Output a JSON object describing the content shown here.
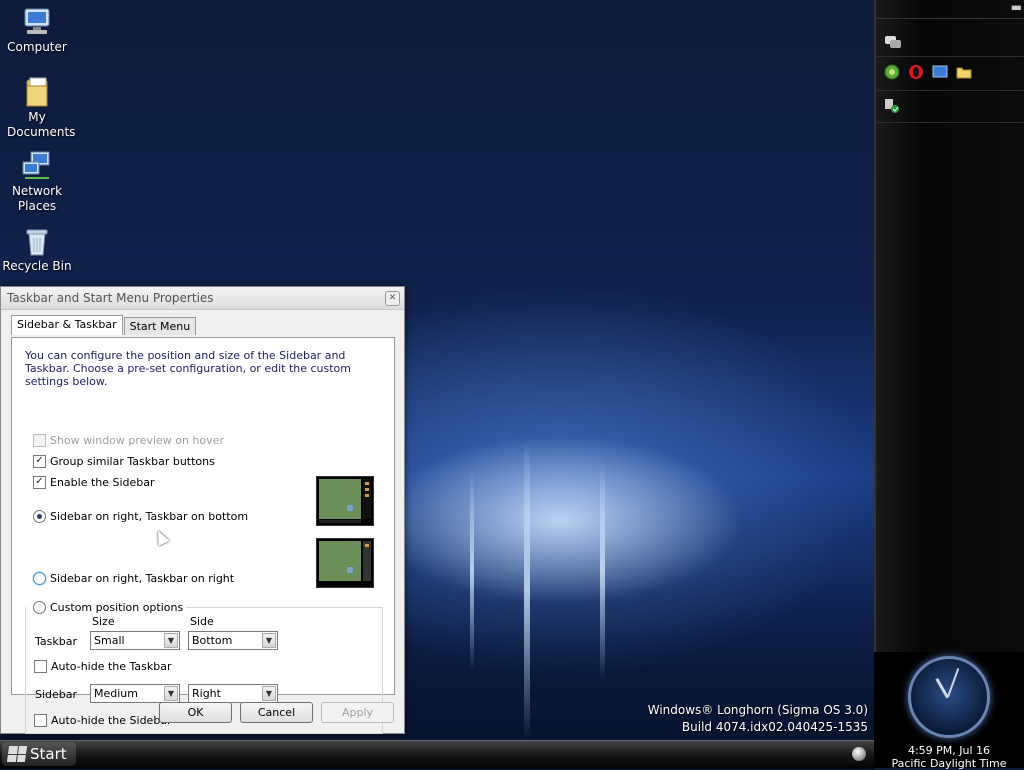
{
  "desktop": {
    "icons": [
      {
        "label": "Computer",
        "icon": "computer-icon"
      },
      {
        "label": "My Documents",
        "icon": "documents-folder-icon"
      },
      {
        "label": "Network Places",
        "icon": "network-icon"
      },
      {
        "label": "Recycle Bin",
        "icon": "recycle-bin-icon"
      }
    ],
    "watermark": {
      "line1": "Windows® Longhorn (Sigma OS 3.0)",
      "line2": "Build 4074.idx02.040425-1535"
    }
  },
  "sidebar": {
    "close_glyph": "▬",
    "tiles": [
      "chat-bubble-icon",
      "green-orb-icon",
      "opera-icon",
      "screen-icon",
      "folder-icon",
      "task-check-icon"
    ],
    "clock": {
      "time": "4:59 PM, Jul 16",
      "timezone": "Pacific Daylight Time"
    }
  },
  "taskbar": {
    "start_label": "Start"
  },
  "dialog": {
    "title": "Taskbar and Start Menu Properties",
    "close_glyph": "✕",
    "tabs": [
      {
        "label": "Sidebar & Taskbar",
        "active": true
      },
      {
        "label": "Start Menu",
        "active": false
      }
    ],
    "description": "You can configure the position and size of the Sidebar and Taskbar. Choose a pre-set configuration, or edit the custom settings below.",
    "options": {
      "show_preview": {
        "label": "Show window preview on hover",
        "checked": false,
        "enabled": false
      },
      "group_buttons": {
        "label": "Group similar Taskbar buttons",
        "checked": true
      },
      "enable_sidebar": {
        "label": "Enable the Sidebar",
        "checked": true
      }
    },
    "radios": {
      "right_bottom": {
        "label": "Sidebar on right, Taskbar on bottom",
        "selected": true
      },
      "right_right": {
        "label": "Sidebar on right, Taskbar on right",
        "selected": false
      },
      "custom": {
        "label": "Custom position options",
        "selected": false
      }
    },
    "custom": {
      "size_header": "Size",
      "side_header": "Side",
      "taskbar_label": "Taskbar",
      "taskbar_size": "Small",
      "taskbar_side": "Bottom",
      "autohide_taskbar": "Auto-hide the Taskbar",
      "sidebar_label": "Sidebar",
      "sidebar_size": "Medium",
      "sidebar_side": "Right",
      "autohide_sidebar": "Auto-hide the Sidebar",
      "dropdown_glyph": "▼"
    },
    "buttons": {
      "ok": "OK",
      "cancel": "Cancel",
      "apply": "Apply"
    }
  },
  "colors": {
    "accent": "#2c3e6b",
    "desc_text": "#1e1e60"
  }
}
